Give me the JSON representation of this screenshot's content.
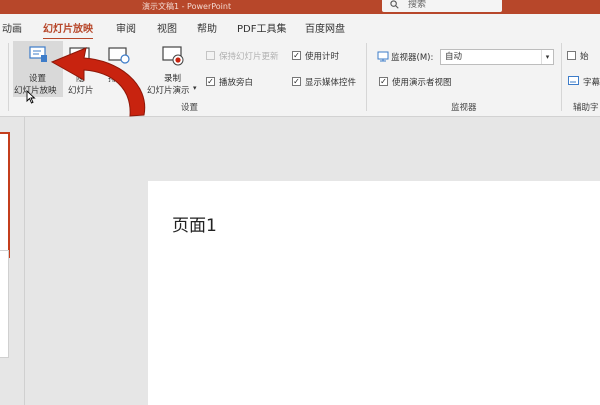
{
  "titlebar": {
    "title": "演示文稿1 - PowerPoint",
    "search_label": "搜索"
  },
  "tabs": [
    {
      "label": "动画",
      "active": false
    },
    {
      "label": "幻灯片放映",
      "active": true
    },
    {
      "label": "审阅",
      "active": false
    },
    {
      "label": "视图",
      "active": false
    },
    {
      "label": "帮助",
      "active": false
    },
    {
      "label": "PDF工具集",
      "active": false
    },
    {
      "label": "百度网盘",
      "active": false
    }
  ],
  "ribbon": {
    "setup_button": {
      "line1": "设置",
      "line2": "幻灯片放映"
    },
    "hide_button": {
      "line1": "隐",
      "line2": "幻灯片"
    },
    "rehearse_button": {
      "line1": "排"
    },
    "record_button": {
      "line1": "录制",
      "line2": "幻灯片演示"
    },
    "keep_updated": {
      "label": "保持幻灯片更新",
      "checked": true,
      "disabled": true
    },
    "play_narrations": {
      "label": "播放旁白",
      "checked": true
    },
    "use_timings": {
      "label": "使用计时",
      "checked": true
    },
    "show_media_controls": {
      "label": "显示媒体控件",
      "checked": true
    },
    "setup_group_label": "设置",
    "monitor": {
      "label": "监视器(M):",
      "value": "自动"
    },
    "presenter_view": {
      "label": "使用演示者视图",
      "checked": true
    },
    "monitor_group_label": "监视器",
    "always_label": "始",
    "subtitle_label": "字幕",
    "captions_group_label": "辅助字"
  },
  "slide": {
    "text": "页面1"
  },
  "colors": {
    "accent": "#b7472a",
    "arrow": "#c8230f"
  }
}
